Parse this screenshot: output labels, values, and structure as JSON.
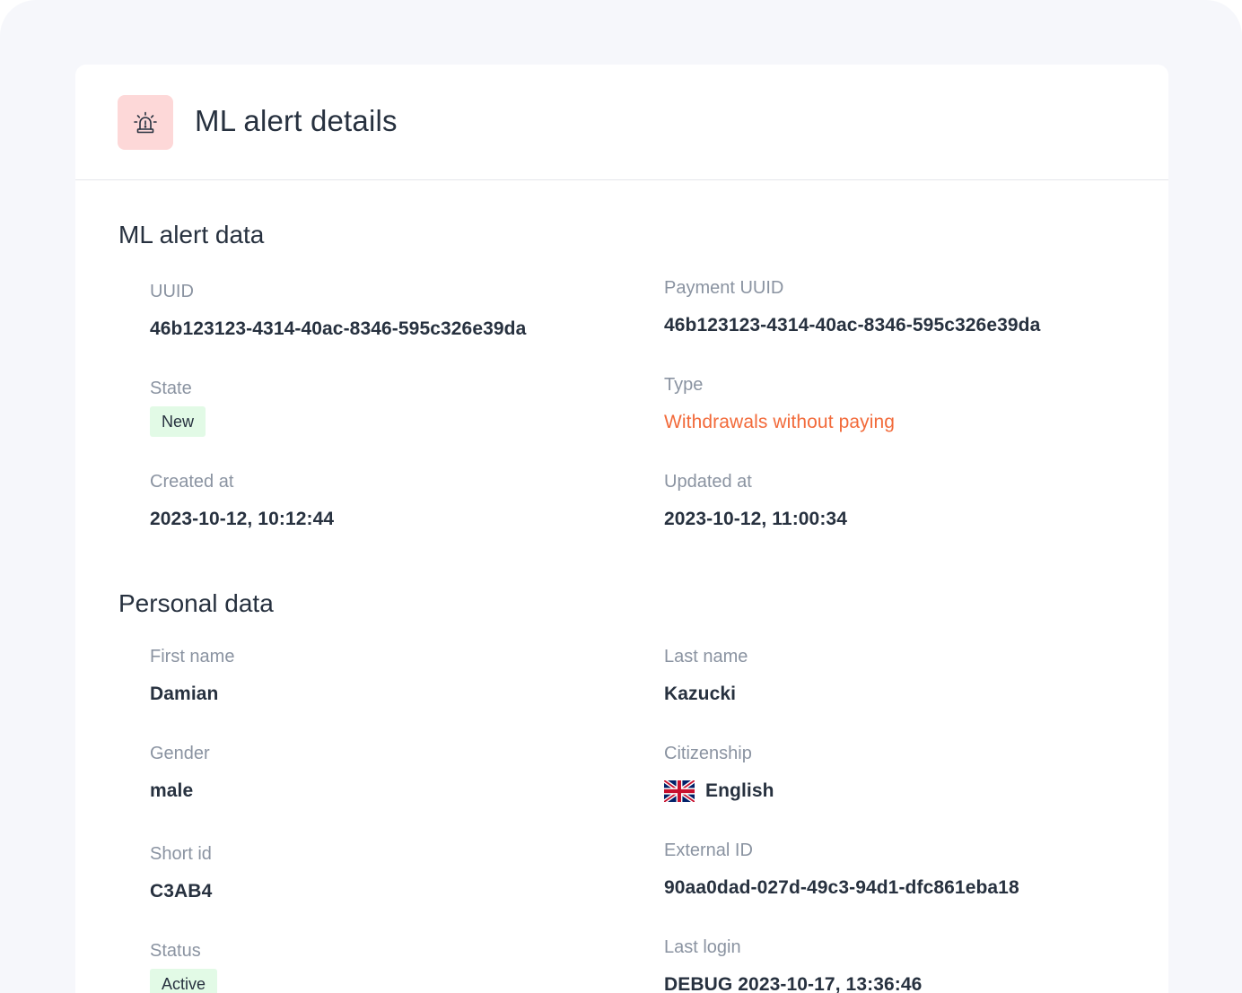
{
  "header": {
    "title": "ML alert details",
    "icon": "siren-icon"
  },
  "alert_section": {
    "title": "ML alert data",
    "uuid": {
      "label": "UUID",
      "value": "46b123123-4314-40ac-8346-595c326e39da"
    },
    "payment_uuid": {
      "label": "Payment UUID",
      "value": "46b123123-4314-40ac-8346-595c326e39da"
    },
    "state": {
      "label": "State",
      "value": "New"
    },
    "type": {
      "label": "Type",
      "value": "Withdrawals without paying",
      "color": "#f26a3a"
    },
    "created_at": {
      "label": "Created at",
      "value": "2023-10-12, 10:12:44"
    },
    "updated_at": {
      "label": "Updated at",
      "value": "2023-10-12, 11:00:34"
    }
  },
  "personal_section": {
    "title": "Personal data",
    "first_name": {
      "label": "First name",
      "value": "Damian"
    },
    "last_name": {
      "label": "Last name",
      "value": "Kazucki"
    },
    "gender": {
      "label": "Gender",
      "value": "male"
    },
    "citizenship": {
      "label": "Citizenship",
      "value": "English",
      "flag": "uk-flag-icon"
    },
    "short_id": {
      "label": "Short id",
      "value": "C3AB4"
    },
    "external_id": {
      "label": "External ID",
      "value": "90aa0dad-027d-49c3-94d1-dfc861eba18"
    },
    "status": {
      "label": "Status",
      "value": "Active"
    },
    "last_login": {
      "label": "Last login",
      "value": "DEBUG 2023-10-17, 13:36:46"
    }
  },
  "colors": {
    "badge_bg": "#e2fae6",
    "icon_bg": "#fdd8d8",
    "accent_orange": "#f26a3a"
  }
}
